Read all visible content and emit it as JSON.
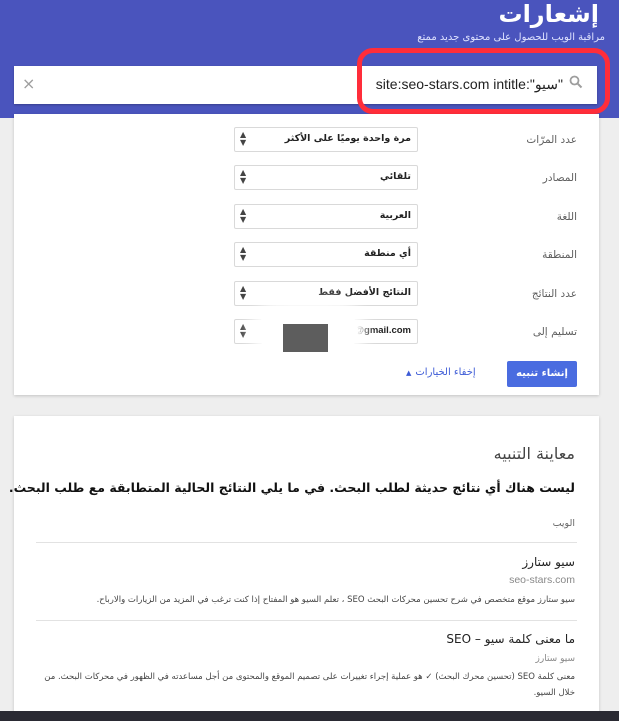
{
  "header": {
    "title": "إشعارات",
    "subtitle": "مراقبة الويب للحصول على محتوى جديد ممتع"
  },
  "search": {
    "query": "site:seo-stars.com intitle:\"سيو\"",
    "clear_icon": "×"
  },
  "options": {
    "rows": [
      {
        "label": "عدد المرّات",
        "value": "مرة واحدة يوميًا على الأكثر"
      },
      {
        "label": "المصادر",
        "value": "تلقائي"
      },
      {
        "label": "اللغة",
        "value": "العربية"
      },
      {
        "label": "المنطقة",
        "value": "أي منطقة"
      },
      {
        "label": "عدد النتائج",
        "value": "النتائج الأفضل فقط"
      },
      {
        "label": "تسليم إلى",
        "value": "@gmail.com"
      }
    ],
    "create_button": "إنشاء تنبيه",
    "hide_options": "إخفاء الخيارات"
  },
  "preview": {
    "title": "معاينة التنبيه",
    "no_results": "ليست هناك أي نتائج حديثة لطلب البحث. في ما يلي النتائج الحالية المتطابقة مع طلب البحث.",
    "section_label": "الويب",
    "results": [
      {
        "title": "سيو ستارز",
        "url": "seo-stars.com",
        "snippet": "سيو ستارز موقع متخصص في شرح تحسين محركات البحث SEO ، تعلم السيو هو المفتاح إذا كنت ترغب في المزيد من الزيارات والارباح."
      },
      {
        "title": "ما معنى كلمة سيو – SEO",
        "source": "سيو ستارز",
        "snippet": "معنى كلمة SEO (تحسين محرك البحث) ✓ هو عملية إجراء تغييرات على تصميم الموقع والمحتوى من أجل مساعدته في الظهور في محركات البحث. من خلال السيو."
      }
    ]
  },
  "colors": {
    "header_bg": "#4a54bd",
    "accent": "#4a6ce0",
    "highlight": "#ff2d3a"
  }
}
